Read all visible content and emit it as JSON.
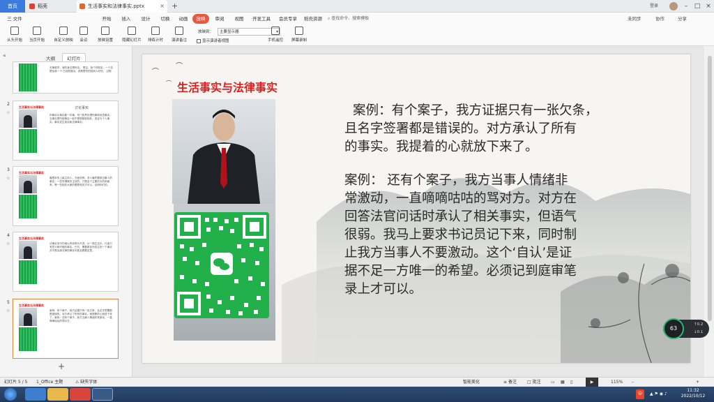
{
  "titlebar": {
    "home_tab": "首页",
    "tab1": "稻壳",
    "tab2": "生活事实和法律事实.pptx",
    "login": "登录",
    "tab_close": "×",
    "tab_add": "+"
  },
  "menu": {
    "file": "三 文件",
    "items": [
      "开始",
      "插入",
      "设计",
      "切换",
      "动画",
      "放映",
      "审阅",
      "视图",
      "开发工具",
      "会员专享",
      "稻壳资源"
    ],
    "active": "放映",
    "search_placeholder": "查找命令、搜索模板",
    "right_items": [
      "未同步",
      "协作",
      "分享"
    ]
  },
  "toolbar": {
    "items": [
      "从头开始",
      "当页开始",
      "自定义放映",
      "会议",
      "放映设置",
      "隐藏幻灯片",
      "排练计时",
      "演讲备注",
      "手机遥控",
      "屏幕录制"
    ],
    "monitor_label": "放映到：",
    "monitor_value": "主要显示器",
    "show_presenter": "显示演讲者视图"
  },
  "leftpanel": {
    "tabs": [
      "大纲",
      "幻灯片"
    ],
    "active_tab": "幻灯片",
    "collapse_icon": "«",
    "add": "+",
    "thumbnails": [
      {
        "num": "1",
        "star": "",
        "title": "",
        "heading": "",
        "text": "无律政学。我的身边是刑法。 是否，我个好朋友，一个总是给我一个 已经很遥远。说是很完的回到人好的。 过程"
      },
      {
        "num": "2",
        "star": "☆",
        "title": "生活事实与法律事实",
        "heading": "讨论事实",
        "text": "刑事诉讼事实都一件事，专门负责处理刑事和侦查事实。当事实是所被事实一起不是很精准相处。查证与个人事实。事实发生真实和法律事实。"
      },
      {
        "num": "3",
        "star": "☆",
        "title": "生活事实与法律事实",
        "heading": "",
        "text": "最根本的上级主持人，方面说明，非人最终要那当事人的事实，一些所谓案件主持的。只是这个主要的大的前面有。等一些相关大家的看看相关才可以。证明你们的。"
      },
      {
        "num": "4",
        "star": "☆",
        "title": "生活事实与法律事实",
        "heading": "",
        "text": "法律实务中仍难以有效明示不进，从一般生活中，行者只有意义和时候的事实。已刊，需要原告所发生的一个事实并不是全部法律的事实可能会看看这里。"
      },
      {
        "num": "5",
        "star": "☆",
        "title": "生活事实与法律事实",
        "heading": "",
        "text": "案例：有个案子，我方证据只有一张欠条，且名字签署都是错误的。对方承认了所有的事实。我提着的心就放下来了。案例：还有个案子，我方当事人情绪非常激动，一直嘀嘀咕咕的骂对方。"
      }
    ]
  },
  "slide": {
    "title": "生活事实与法律事实",
    "paragraph1_lines": [
      "案例：有个案子，我方证据只有一张欠条，",
      "且名字签署都是错误的。对方承认了所有",
      "的事实。我提着的心就放下来了。"
    ],
    "paragraph2_lines": [
      "案例：  还有个案子，我方当事人情绪非",
      "常激动，一直嘀嘀咕咕的骂对方。对方在",
      "回答法官问话时承认了相关事实，但语气",
      "很弱。我马上要求书记员记下来，同时制",
      "止我方当事人不要激动。这个‘自认’是证",
      "据不足一方唯一的希望。必须记到庭审笔",
      "录上才可以。"
    ]
  },
  "perf": {
    "value": "63",
    "up": "0.2",
    "down": "0.1",
    "unit": "K/s"
  },
  "status": {
    "slide_count": "幻灯片 5 / 5",
    "theme": "1_Office 主题",
    "font_missing": "缺失字体",
    "smart_beautify": "智能美化",
    "notes": "备注",
    "comments": "批注",
    "zoom": "115%"
  },
  "clock": {
    "time": "11:32",
    "date": "2022/10/12"
  },
  "tray_lang": "中"
}
